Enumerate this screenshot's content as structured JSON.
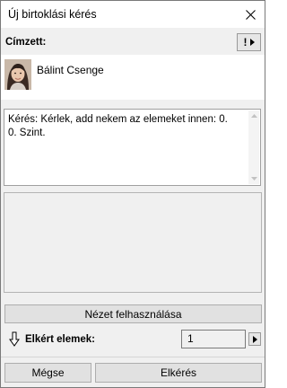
{
  "window": {
    "title": "Új birtoklási kérés",
    "close_glyph": "✕",
    "close_icon": "close-icon"
  },
  "recipient": {
    "label": "Címzett:",
    "priority_glyph": "!",
    "priority_icon": "exclamation-icon",
    "menu_icon": "triangle-right-icon",
    "name": "Bálint Csenge"
  },
  "message": {
    "text": "Kérés: Kérlek, add nekem az elemeket innen: 0. 0. Szint."
  },
  "buttons": {
    "use_view": "Nézet felhasználása",
    "cancel": "Mégse",
    "request": "Elkérés"
  },
  "requested": {
    "label": "Elkért elemek:",
    "value": "1",
    "icon": "down-arrow-icon"
  },
  "colors": {
    "window_bg": "#f0f0f0",
    "button_bg": "#e1e1e1",
    "border": "#adadad"
  }
}
